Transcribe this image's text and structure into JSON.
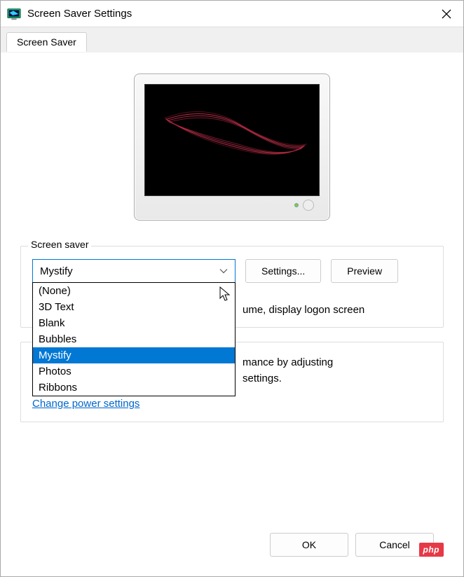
{
  "window": {
    "title": "Screen Saver Settings"
  },
  "tabs": [
    {
      "label": "Screen Saver"
    }
  ],
  "screensaver_group": {
    "legend": "Screen saver",
    "selected": "Mystify",
    "options": [
      "(None)",
      "3D Text",
      "Blank",
      "Bubbles",
      "Mystify",
      "Photos",
      "Ribbons"
    ],
    "settings_button": "Settings...",
    "preview_button": "Preview",
    "resume_text": "ume, display logon screen"
  },
  "power_group": {
    "line1": "mance by adjusting",
    "line2": "settings.",
    "link": "Change power settings"
  },
  "buttons": {
    "ok": "OK",
    "cancel": "Cancel"
  },
  "badge": "php",
  "colors": {
    "accent": "#0078d4",
    "link": "#0066cc"
  }
}
